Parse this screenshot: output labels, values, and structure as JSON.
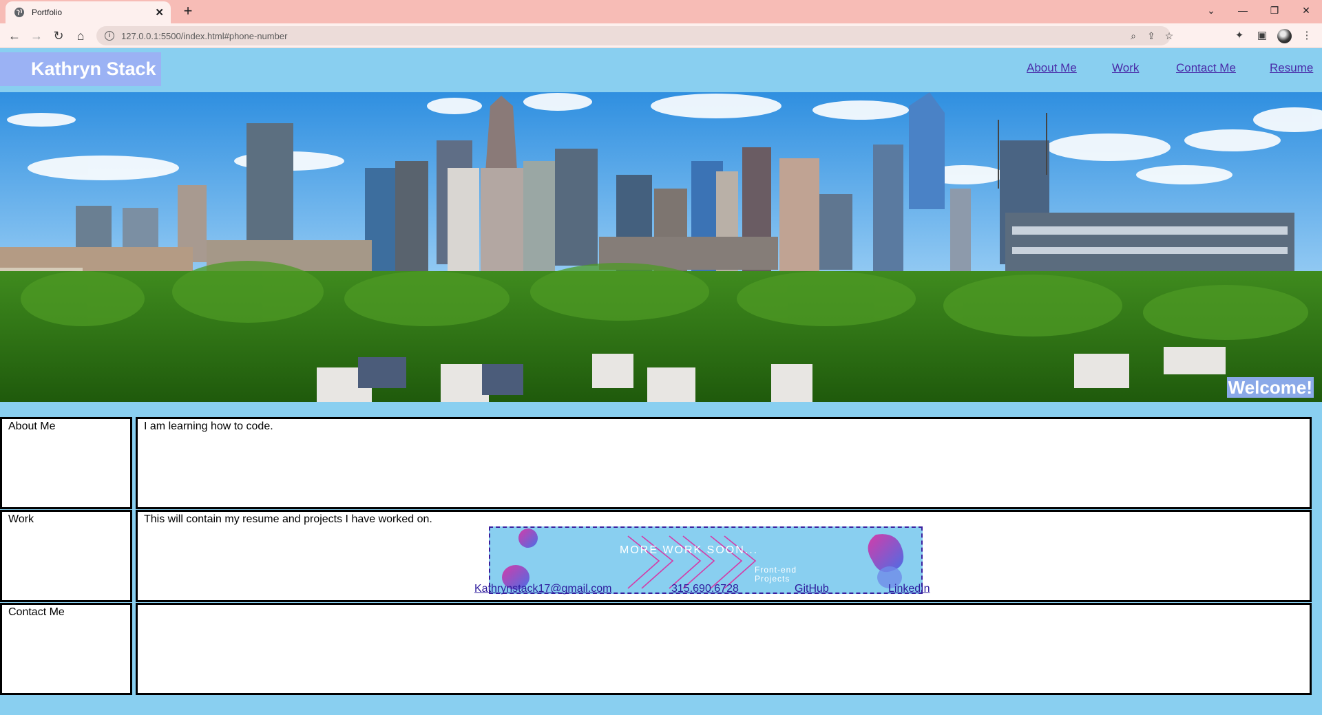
{
  "browser": {
    "tab_title": "Portfolio",
    "tab_close": "✕",
    "new_tab": "+",
    "url": "127.0.0.1:5500/index.html#phone-number",
    "window_controls": [
      "⌄",
      "—",
      "❐",
      "✕"
    ]
  },
  "header": {
    "brand": "Kathryn Stack",
    "nav": [
      "About Me",
      "Work",
      "Contact Me",
      "Resume"
    ]
  },
  "hero": {
    "welcome": "Welcome!"
  },
  "sections": {
    "about": {
      "label": "About Me",
      "text": "I am learning how to code."
    },
    "work": {
      "label": "Work",
      "text": "This will contain my resume and projects I have worked on.",
      "banner_title": "MORE WORK SOON...",
      "banner_sub": "Front-end Projects"
    },
    "contact": {
      "label": "Contact Me",
      "links": [
        "Kathrynstack17@gmail.com",
        "315.690.6728",
        "GitHub",
        "LinkedIn"
      ]
    }
  },
  "colors": {
    "page_bg": "#89cff0",
    "brand_bg": "#9bb2f4",
    "nav_link": "#4a2ca8",
    "tab_strip": "#f7bcb6"
  }
}
